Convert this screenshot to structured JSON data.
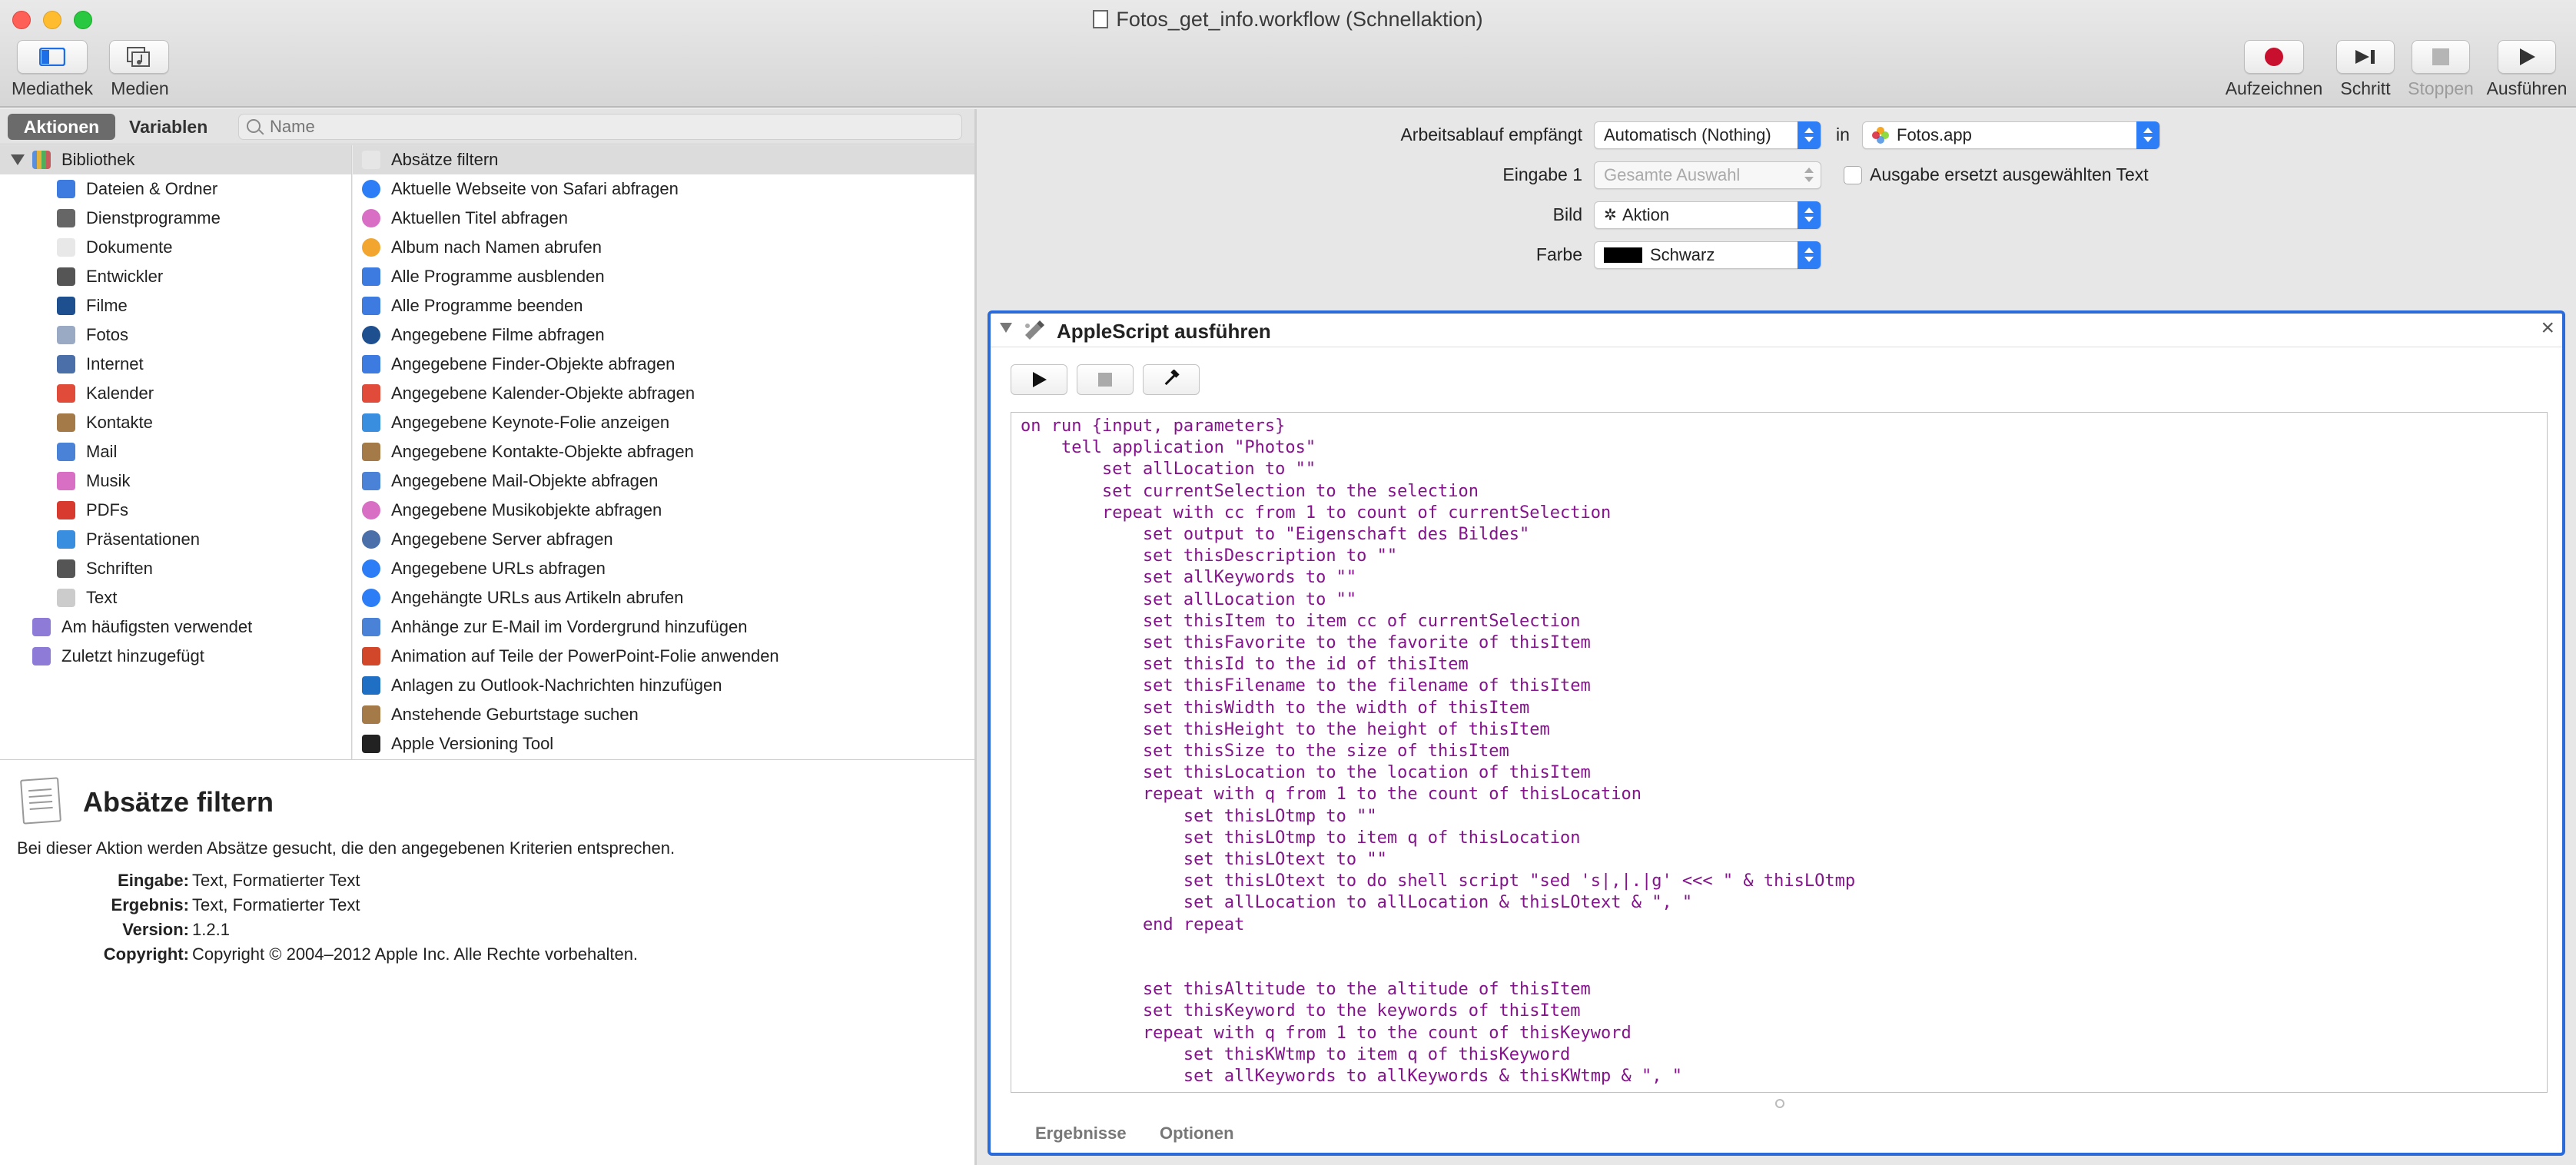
{
  "window": {
    "title": "Fotos_get_info.workflow (Schnellaktion)"
  },
  "toolbar": {
    "library": "Mediathek",
    "media": "Medien",
    "record": "Aufzeichnen",
    "step": "Schritt",
    "stop": "Stoppen",
    "run": "Ausführen"
  },
  "left_tabs": {
    "actions": "Aktionen",
    "variables": "Variablen",
    "search_placeholder": "Name"
  },
  "library": {
    "root": "Bibliothek",
    "items": [
      {
        "label": "Dateien & Ordner",
        "icon": "finder-icon",
        "color": "#3d7be0"
      },
      {
        "label": "Dienstprogramme",
        "icon": "tools-icon",
        "color": "#666666"
      },
      {
        "label": "Dokumente",
        "icon": "document-icon",
        "color": "#e8e8e8"
      },
      {
        "label": "Entwickler",
        "icon": "tools-icon",
        "color": "#555555"
      },
      {
        "label": "Filme",
        "icon": "quicktime-icon",
        "color": "#1e4f8f"
      },
      {
        "label": "Fotos",
        "icon": "photos-icon",
        "color": "#9aa9c4"
      },
      {
        "label": "Internet",
        "icon": "globe-icon",
        "color": "#4b6fa8"
      },
      {
        "label": "Kalender",
        "icon": "calendar-icon",
        "color": "#e04b3a"
      },
      {
        "label": "Kontakte",
        "icon": "contacts-icon",
        "color": "#a47a48"
      },
      {
        "label": "Mail",
        "icon": "mail-icon",
        "color": "#4a82d8"
      },
      {
        "label": "Musik",
        "icon": "music-icon",
        "color": "#d86fc4"
      },
      {
        "label": "PDFs",
        "icon": "pdf-icon",
        "color": "#d93a2f"
      },
      {
        "label": "Präsentationen",
        "icon": "keynote-icon",
        "color": "#3a8ee0"
      },
      {
        "label": "Schriften",
        "icon": "fonts-icon",
        "color": "#555555"
      },
      {
        "label": "Text",
        "icon": "text-icon",
        "color": "#cccccc"
      }
    ],
    "smart": [
      {
        "label": "Am häufigsten verwendet",
        "icon": "smart-folder-icon",
        "color": "#8e7bd8"
      },
      {
        "label": "Zuletzt hinzugefügt",
        "icon": "smart-folder-icon",
        "color": "#8e7bd8"
      }
    ]
  },
  "actions": [
    {
      "label": "Absätze filtern",
      "icon": "text-icon",
      "color": "#e6e6e6"
    },
    {
      "label": "Aktuelle Webseite von Safari abfragen",
      "icon": "safari-icon",
      "color": "#2d7df6"
    },
    {
      "label": "Aktuellen Titel abfragen",
      "icon": "music-icon",
      "color": "#d86fc4"
    },
    {
      "label": "Album nach Namen abrufen",
      "icon": "photos-icon",
      "color": "#f2a630"
    },
    {
      "label": "Alle Programme ausblenden",
      "icon": "finder-icon",
      "color": "#3d7be0"
    },
    {
      "label": "Alle Programme beenden",
      "icon": "finder-icon",
      "color": "#3d7be0"
    },
    {
      "label": "Angegebene Filme abfragen",
      "icon": "quicktime-icon",
      "color": "#1e4f8f"
    },
    {
      "label": "Angegebene Finder-Objekte abfragen",
      "icon": "finder-icon",
      "color": "#3d7be0"
    },
    {
      "label": "Angegebene Kalender-Objekte abfragen",
      "icon": "calendar-icon",
      "color": "#e04b3a"
    },
    {
      "label": "Angegebene Keynote-Folie anzeigen",
      "icon": "keynote-icon",
      "color": "#3a8ee0"
    },
    {
      "label": "Angegebene Kontakte-Objekte abfragen",
      "icon": "contacts-icon",
      "color": "#a47a48"
    },
    {
      "label": "Angegebene Mail-Objekte abfragen",
      "icon": "mail-icon",
      "color": "#4a82d8"
    },
    {
      "label": "Angegebene Musikobjekte abfragen",
      "icon": "music-icon",
      "color": "#d86fc4"
    },
    {
      "label": "Angegebene Server abfragen",
      "icon": "globe-icon",
      "color": "#4b6fa8"
    },
    {
      "label": "Angegebene URLs abfragen",
      "icon": "safari-icon",
      "color": "#2d7df6"
    },
    {
      "label": "Angehängte URLs aus Artikeln abrufen",
      "icon": "safari-icon",
      "color": "#2d7df6"
    },
    {
      "label": "Anhänge zur E-Mail im Vordergrund hinzufügen",
      "icon": "mail-icon",
      "color": "#4a82d8"
    },
    {
      "label": "Animation auf Teile der PowerPoint-Folie anwenden",
      "icon": "powerpoint-icon",
      "color": "#d2472a"
    },
    {
      "label": "Anlagen zu Outlook-Nachrichten hinzufügen",
      "icon": "outlook-icon",
      "color": "#1f6fc5"
    },
    {
      "label": "Anstehende Geburtstage suchen",
      "icon": "contacts-icon",
      "color": "#a47a48"
    },
    {
      "label": "Apple Versioning Tool",
      "icon": "terminal-icon",
      "color": "#222222"
    }
  ],
  "info": {
    "title": "Absätze filtern",
    "description": "Bei dieser Aktion werden Absätze gesucht, die den angegebenen Kriterien entsprechen.",
    "input_label": "Eingabe:",
    "input": "Text, Formatierter Text",
    "result_label": "Ergebnis:",
    "result": "Text, Formatierter Text",
    "version_label": "Version:",
    "version": "1.2.1",
    "copyright_label": "Copyright:",
    "copyright": "Copyright © 2004–2012 Apple Inc. Alle Rechte vorbehalten."
  },
  "workflow": {
    "receives_label": "Arbeitsablauf empfängt",
    "receives_value": "Automatisch (Nothing)",
    "in_label": "in",
    "app_value": "Fotos.app",
    "input_label": "Eingabe 1",
    "input_value": "Gesamte Auswahl",
    "replace_label": "Ausgabe ersetzt ausgewählten Text",
    "image_label": "Bild",
    "image_value": "Aktion",
    "color_label": "Farbe",
    "color_value": "Schwarz",
    "color_swatch": "#000000"
  },
  "action_block": {
    "title": "AppleScript ausführen",
    "close": "×",
    "code": "on run {input, parameters}\n    tell application \"Photos\"\n        set allLocation to \"\"\n        set currentSelection to the selection\n        repeat with cc from 1 to count of currentSelection\n            set output to \"Eigenschaft des Bildes\"\n            set thisDescription to \"\"\n            set allKeywords to \"\"\n            set allLocation to \"\"\n            set thisItem to item cc of currentSelection\n            set thisFavorite to the favorite of thisItem\n            set thisId to the id of thisItem\n            set thisFilename to the filename of thisItem\n            set thisWidth to the width of thisItem\n            set thisHeight to the height of thisItem\n            set thisSize to the size of thisItem\n            set thisLocation to the location of thisItem\n            repeat with q from 1 to the count of thisLocation\n                set thisLOtmp to \"\"\n                set thisLOtmp to item q of thisLocation\n                set thisLOtext to \"\"\n                set thisLOtext to do shell script \"sed 's|,|.|g' <<< \" & thisLOtmp\n                set allLocation to allLocation & thisLOtext & \", \"\n            end repeat\n\n\n            set thisAltitude to the altitude of thisItem\n            set thisKeyword to the keywords of thisItem\n            repeat with q from 1 to the count of thisKeyword\n                set thisKWtmp to item q of thisKeyword\n                set allKeywords to allKeywords & thisKWtmp & \", \"",
    "tab_results": "Ergebnisse",
    "tab_options": "Optionen"
  },
  "colors": {
    "accent": "#2a6ad9",
    "popup_arrow": "#2d7df6",
    "code_text": "#84138c",
    "record": "#c8102e"
  }
}
